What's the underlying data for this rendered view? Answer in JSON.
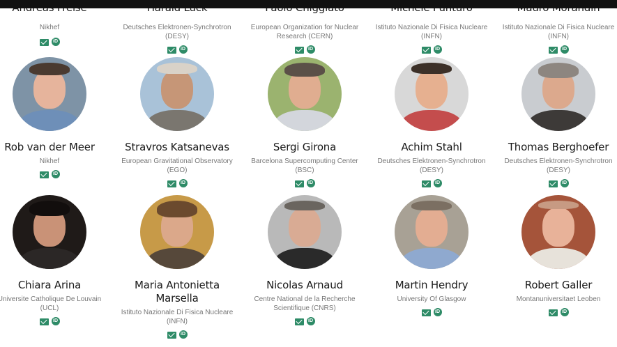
{
  "top_row": [
    {
      "name": "Andreas Freise",
      "inst": "Nikhef"
    },
    {
      "name": "Harald Lück",
      "inst": "Deutsches Elektronen-Synchrotron (DESY)"
    },
    {
      "name": "Paolo Chiggiato",
      "inst": "European Organization for Nuclear Research (CERN)"
    },
    {
      "name": "Michele Punturo",
      "inst": "Istituto Nazionale Di Fisica Nucleare (INFN)"
    },
    {
      "name": "Mauro Morandin",
      "inst": "Istituto Nazionale Di Fisica Nucleare (INFN)"
    }
  ],
  "row2": [
    {
      "name": "Rob van der Meer",
      "inst": "Nikhef"
    },
    {
      "name": "Stravros Katsanevas",
      "inst": "European Gravitational Observatory (EGO)"
    },
    {
      "name": "Sergi Girona",
      "inst": "Barcelona Supercomputing Center (BSC)"
    },
    {
      "name": "Achim Stahl",
      "inst": "Deutsches Elektronen-Synchrotron (DESY)"
    },
    {
      "name": "Thomas Berghoefer",
      "inst": "Deutsches Elektronen-Synchrotron (DESY)"
    }
  ],
  "row3": [
    {
      "name": "Chiara Arina",
      "inst": "Universite Catholique De Louvain (UCL)"
    },
    {
      "name": "Maria Antonietta Marsella",
      "inst": "Istituto Nazionale Di Fisica Nucleare (INFN)"
    },
    {
      "name": "Nicolas Arnaud",
      "inst": "Centre National de la Recherche Scientifique (CNRS)"
    },
    {
      "name": "Martin Hendry",
      "inst": "University Of Glasgow"
    },
    {
      "name": "Robert Galler",
      "inst": "Montanuniversitaet Leoben"
    }
  ],
  "icons": {
    "mail": "mail-icon",
    "orcid": "orcid-icon",
    "orcid_glyph": "iD"
  },
  "colors": {
    "accent": "#2e8b67"
  }
}
